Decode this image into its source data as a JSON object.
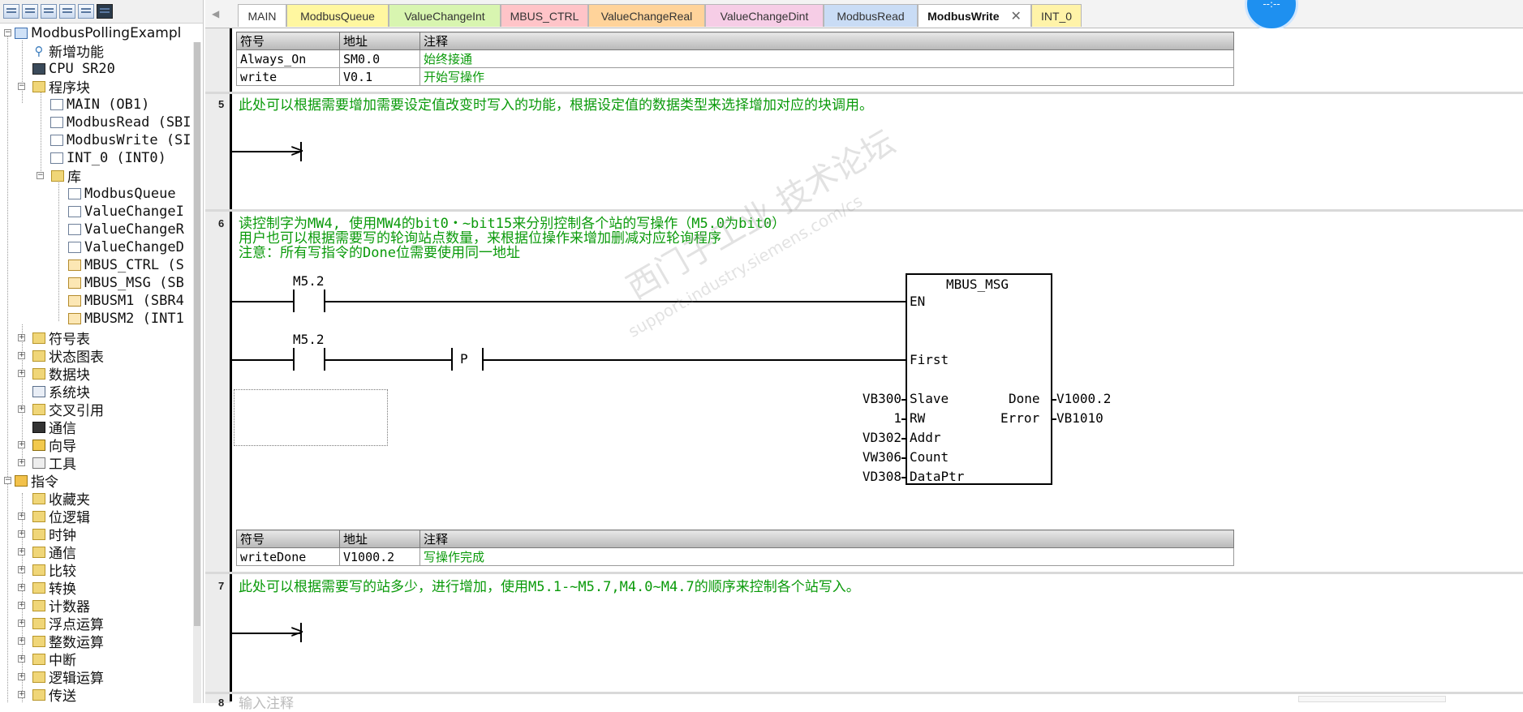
{
  "tree": {
    "project": "ModbusPollingExampl",
    "new_feature": "新增功能",
    "cpu": "CPU SR20",
    "program_blocks": "程序块",
    "blocks": [
      "MAIN (OB1)",
      "ModbusRead (SBI",
      "ModbusWrite (SI",
      "INT_0 (INT0)"
    ],
    "library": "库",
    "library_items": [
      "ModbusQueue",
      "ValueChangeI",
      "ValueChangeR",
      "ValueChangeD",
      "MBUS_CTRL (S",
      "MBUS_MSG (SB",
      "MBUSM1 (SBR4",
      "MBUSM2 (INT1"
    ],
    "symbol_table": "符号表",
    "status_chart": "状态图表",
    "data_block": "数据块",
    "system_block": "系统块",
    "cross_ref": "交叉引用",
    "communication": "通信",
    "wizard": "向导",
    "tools": "工具",
    "instructions": "指令",
    "instruction_items": [
      "收藏夹",
      "位逻辑",
      "时钟",
      "通信",
      "比较",
      "转换",
      "计数器",
      "浮点运算",
      "整数运算",
      "中断",
      "逻辑运算",
      "传送"
    ]
  },
  "tabs": [
    {
      "label": "MAIN",
      "color": "#ffffff"
    },
    {
      "label": "ModbusQueue",
      "color": "#fff7a0"
    },
    {
      "label": "ValueChangeInt",
      "color": "#d8f5b0"
    },
    {
      "label": "MBUS_CTRL",
      "color": "#ffc4c8"
    },
    {
      "label": "ValueChangeReal",
      "color": "#ffd39a"
    },
    {
      "label": "ValueChangeDint",
      "color": "#f6cde6"
    },
    {
      "label": "ModbusRead",
      "color": "#c9dcf5"
    },
    {
      "label": "ModbusWrite",
      "color": "#ffffff"
    },
    {
      "label": "INT_0",
      "color": "#fff3a8"
    }
  ],
  "tab_close": "✕",
  "circle_label": "--:--",
  "symtable_headers": {
    "symbol": "符号",
    "address": "地址",
    "comment": "注释"
  },
  "symtable1": [
    {
      "symbol": "Always_On",
      "address": "SM0.0",
      "comment": "始终接通"
    },
    {
      "symbol": "write",
      "address": "V0.1",
      "comment": "开始写操作"
    }
  ],
  "network5": {
    "num": "5",
    "comment": "此处可以根据需要增加需要设定值改变时写入的功能，根据设定值的数据类型来选择增加对应的块调用。"
  },
  "network6": {
    "num": "6",
    "comment_lines": [
      "读控制字为MW4, 使用MW4的bit0・~bit15来分别控制各个站的写操作（M5.0为bit0）",
      "用户也可以根据需要写的轮询站点数量，来根据位操作来增加删减对应轮询程序",
      "注意：所有写指令的Done位需要使用同一地址"
    ],
    "contact1": "M5.2",
    "contact2": "M5.2",
    "p_label": "P",
    "block_title": "MBUS_MSG",
    "pins_in": [
      "EN",
      "First",
      "Slave",
      "RW",
      "Addr",
      "Count",
      "DataPtr"
    ],
    "pins_out": [
      "Done",
      "Error"
    ],
    "in_values": {
      "slave": "VB300",
      "rw": "1",
      "addr": "VD302",
      "count": "VW306",
      "dataptr": "VD308"
    },
    "out_values": {
      "done": "V1000.2",
      "error": "VB1010"
    }
  },
  "symtable2": [
    {
      "symbol": "writeDone",
      "address": "V1000.2",
      "comment": "写操作完成"
    }
  ],
  "network7": {
    "num": "7",
    "comment": "此处可以根据需要写的站多少，进行增加，使用M5.1-~M5.7,M4.0~M4.7的顺序来控制各个站写入。"
  },
  "network8": {
    "num": "8",
    "comment": "输入注释"
  },
  "watermark": {
    "line1": "西门子工业 技术论坛",
    "line2": "support.industry.siemens.com/cs"
  }
}
